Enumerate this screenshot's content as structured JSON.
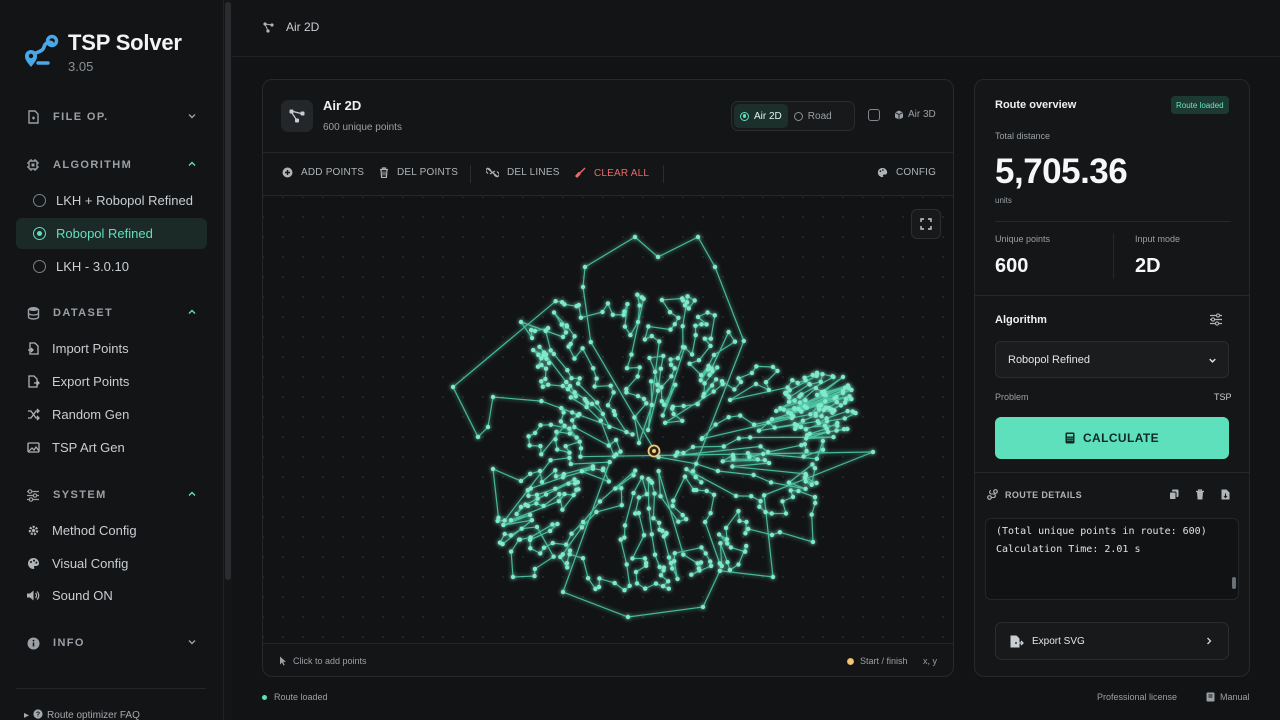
{
  "app": {
    "title": "TSP Solver",
    "version": "3.05"
  },
  "sidebar": {
    "file_section": {
      "label": "FILE OP."
    },
    "algorithm_section": {
      "label": "ALGORITHM",
      "options": [
        {
          "label": "LKH + Robopol Refined",
          "selected": false
        },
        {
          "label": "Robopol Refined",
          "selected": true
        },
        {
          "label": "LKH - 3.0.10",
          "selected": false
        }
      ]
    },
    "dataset_section": {
      "label": "DATASET",
      "items": [
        "Import Points",
        "Export Points",
        "Random Gen",
        "TSP Art Gen"
      ]
    },
    "system_section": {
      "label": "SYSTEM",
      "items": [
        "Method Config",
        "Visual Config",
        "Sound ON"
      ]
    },
    "info_section": {
      "label": "INFO"
    },
    "faq": "Route optimizer FAQ"
  },
  "topbar": {
    "breadcrumb": "Air 2D"
  },
  "map_card": {
    "title": "Air 2D",
    "subtitle": "600 unique points",
    "modes": [
      {
        "label": "Air 2D",
        "selected": true
      },
      {
        "label": "Road",
        "selected": false
      }
    ],
    "air3d_label": "Air 3D",
    "air3d_checked": false,
    "toolbar": {
      "add_points": "ADD POINTS",
      "del_points": "DEL POINTS",
      "del_lines": "DEL LINES",
      "clear_all": "CLEAR ALL",
      "config": "CONFIG"
    },
    "footer": {
      "hint": "Click to add points",
      "legend": "Start / finish",
      "coords": "x, y"
    }
  },
  "route_panel": {
    "title": "Route overview",
    "badge": "Route loaded",
    "total_distance_label": "Total distance",
    "total_distance": "5,705.36",
    "units": "units",
    "unique_points_label": "Unique points",
    "unique_points": "600",
    "input_mode_label": "Input mode",
    "input_mode": "2D",
    "algorithm_label": "Algorithm",
    "algorithm_value": "Robopol Refined",
    "problem_label": "Problem",
    "problem_value": "TSP",
    "calculate_label": "CALCULATE",
    "route_details_label": "ROUTE DETAILS",
    "log_lines": [
      "(Total unique points in route: 600)",
      "Calculation Time: 2.01 s"
    ],
    "export_label": "Export SVG"
  },
  "statusbar": {
    "status": "Route loaded",
    "license": "Professional license",
    "manual": "Manual"
  },
  "colors": {
    "accent": "#5fe0bd",
    "danger": "#e96b6b",
    "start_marker": "#f4c77a",
    "background": "#121314"
  }
}
